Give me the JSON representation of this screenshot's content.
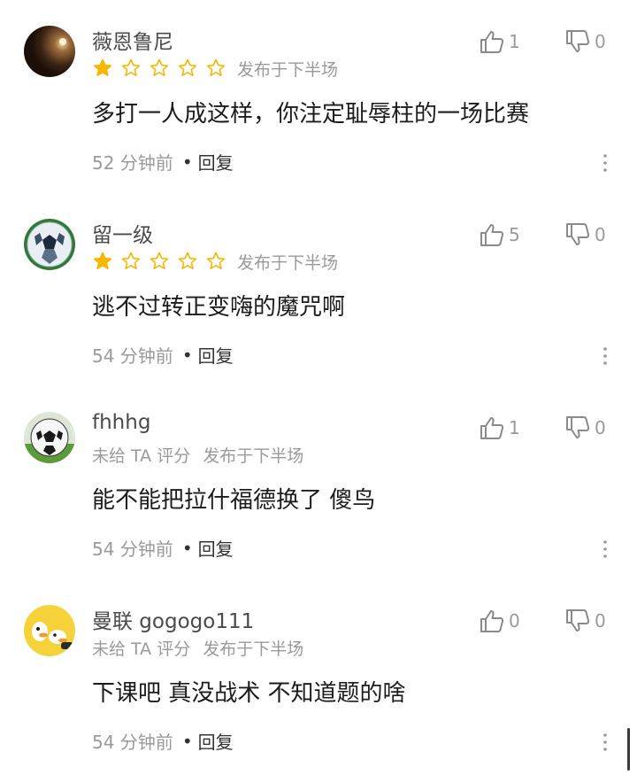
{
  "comments": [
    {
      "username": "薇恩鲁尼",
      "rating": 1,
      "rating_text": "",
      "half": "发布于下半场",
      "content": "多打一人成这样，你注定耻辱柱的一场比赛",
      "time": "52 分钟前",
      "reply": "回复",
      "likes": "1",
      "dislikes": "0"
    },
    {
      "username": "留一级",
      "rating": 1,
      "rating_text": "",
      "half": "发布于下半场",
      "content": "逃不过转正变嗨的魔咒啊",
      "time": "54 分钟前",
      "reply": "回复",
      "likes": "5",
      "dislikes": "0"
    },
    {
      "username": "fhhhg",
      "rating": 0,
      "rating_text": "未给 TA 评分",
      "half": "发布于下半场",
      "content": "能不能把拉什福德换了 傻鸟",
      "time": "54 分钟前",
      "reply": "回复",
      "likes": "1",
      "dislikes": "0"
    },
    {
      "username": "曼联 gogogo111",
      "rating": 0,
      "rating_text": "未给 TA 评分",
      "half": "发布于下半场",
      "content": "下课吧 真没战术 不知道题的啥",
      "time": "54 分钟前",
      "reply": "回复",
      "likes": "0",
      "dislikes": "0"
    }
  ],
  "colors": {
    "star_filled": "#f5b700",
    "star_empty": "#f5b700",
    "meta_text": "#9a9a9a",
    "body_text": "#1c1c1c"
  },
  "icons": [
    "thumbs-up-icon",
    "thumbs-down-icon",
    "more-vertical-icon",
    "star-icon"
  ]
}
